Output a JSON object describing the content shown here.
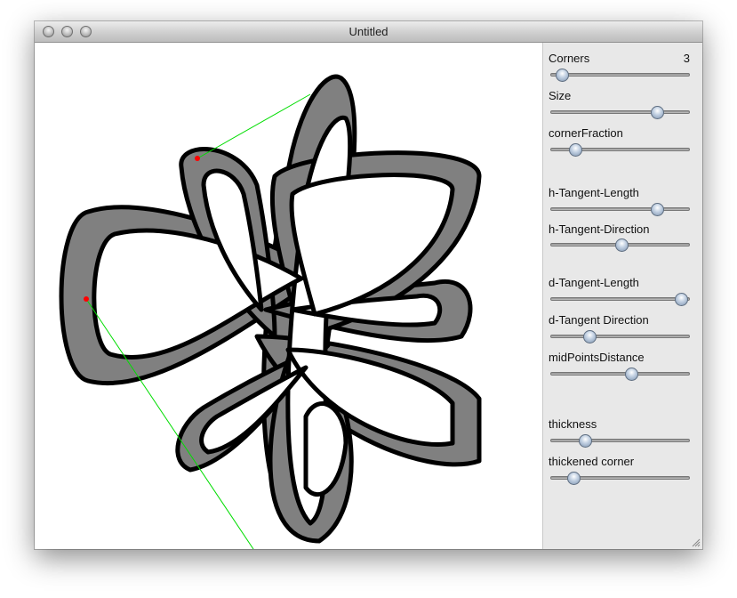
{
  "window": {
    "title": "Untitled",
    "buttons": [
      "close",
      "minimize",
      "zoom"
    ]
  },
  "colors": {
    "shape_fill": "#808080",
    "shape_stroke": "#000000",
    "guide_line": "#00dd00",
    "control_point": "#ff0000"
  },
  "controls": {
    "corners": {
      "label": "Corners",
      "value": "3",
      "level": 0.05
    },
    "size": {
      "label": "Size",
      "level": 0.78
    },
    "corner_fraction": {
      "label": "cornerFraction",
      "level": 0.15
    },
    "h_tangent_length": {
      "label": "h-Tangent-Length",
      "level": 0.78
    },
    "h_tangent_direction": {
      "label": "h-Tangent-Direction",
      "level": 0.51
    },
    "d_tangent_length": {
      "label": "d-Tangent-Length",
      "level": 0.96
    },
    "d_tangent_direction": {
      "label": "d-Tangent Direction",
      "level": 0.26
    },
    "mid_points_distance": {
      "label": "midPointsDistance",
      "level": 0.58
    },
    "thickness": {
      "label": "thickness",
      "level": 0.23
    },
    "thickened_corner": {
      "label": "thickened corner",
      "level": 0.14
    }
  }
}
